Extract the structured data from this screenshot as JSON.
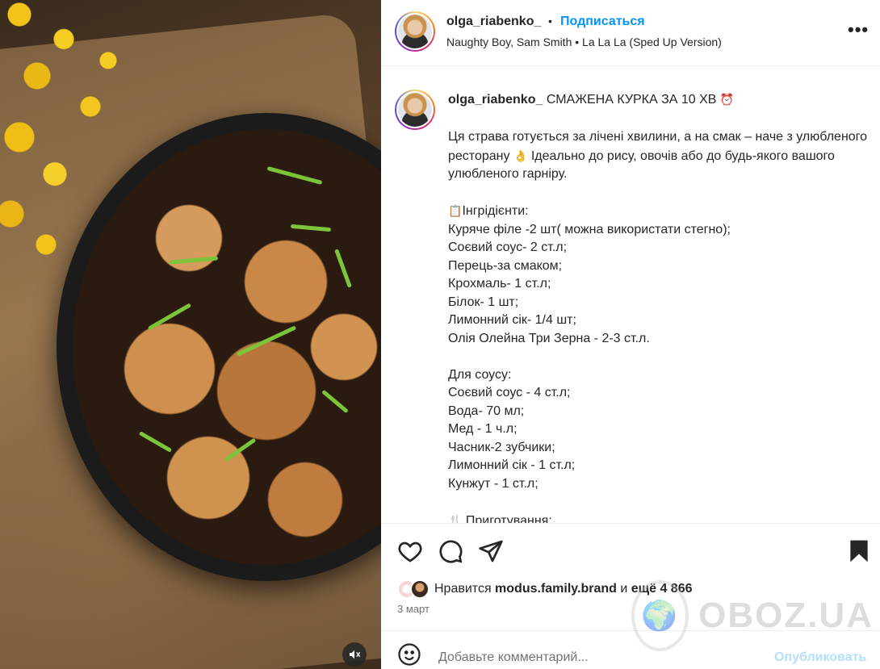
{
  "post": {
    "username": "olga_riabenko_",
    "dot": "•",
    "follow_label": "Подписаться",
    "music": "Naughty Boy, Sam Smith • La La La (Sped Up Version)",
    "more_icon": "more-horizontal-icon"
  },
  "caption": {
    "username": "olga_riabenko_",
    "title": "СМАЖЕНА КУРКА ЗА 10 ХВ",
    "title_emoji": "⏰",
    "intro_1": "Ця страва готується за лічені хвилини, а на смак – наче з улюбленого ресторану",
    "intro_emoji": "👌",
    "intro_2": " Ідеально до рису, овочів або до будь-якого вашого улюбленого гарніру.",
    "ingredients_emoji": "📋",
    "ingredients_heading": "Інгрідієнти:",
    "ingredients": [
      "Куряче філе -2 шт( можна використати стегно);",
      "Соєвий соус- 2 ст.л;",
      "Перець-за смаком;",
      "Крохмаль- 1 ст.л;",
      "Білок- 1 шт;",
      "Лимонний сік- 1/4 шт;",
      "Олія Олейна Три Зерна - 2-3 ст.л."
    ],
    "sauce_heading": "Для соусу:",
    "sauce": [
      "Соєвий соус - 4 ст.л;",
      "Вода- 70 мл;",
      "Мед - 1 ч.л;",
      "Часник-2 зубчики;",
      "Лимонний сік - 1 ст.л;",
      "Кунжут - 1 ст.л;"
    ],
    "cooking_emoji": "🍴",
    "cooking_heading": "Приготування:"
  },
  "actions": {
    "icons": [
      "heart-icon",
      "comment-icon",
      "share-icon",
      "bookmark-icon"
    ]
  },
  "likes": {
    "prefix": "Нравится ",
    "user": "modus.family.brand",
    "middle": " и ",
    "others": "ещё 4 866"
  },
  "date": "3 март",
  "comment": {
    "placeholder": "Добавьте комментарий...",
    "post_label": "Опубликовать"
  },
  "watermark": "OBOZ.UA",
  "colors": {
    "accent": "#0095f6",
    "post_disabled": "#b2dffc",
    "text": "#262626",
    "muted": "#737373"
  }
}
